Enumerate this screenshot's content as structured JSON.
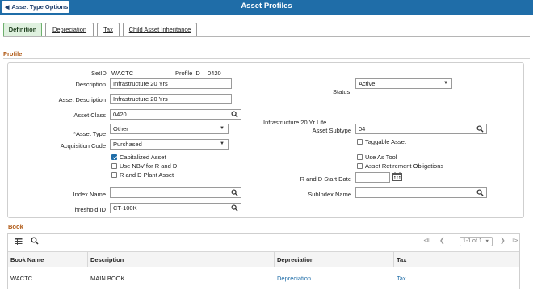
{
  "header": {
    "back_label": "Asset Type Options",
    "title": "Asset Profiles"
  },
  "tabs": [
    {
      "label": "Definition",
      "active": true
    },
    {
      "label": "Depreciation",
      "active": false
    },
    {
      "label": "Tax",
      "active": false
    },
    {
      "label": "Child Asset Inheritance",
      "active": false
    }
  ],
  "profile": {
    "section_title": "Profile",
    "setid_label": "SetID",
    "setid_value": "WACTC",
    "profile_id_label": "Profile ID",
    "profile_id_value": "0420",
    "description_label": "Description",
    "description_value": "Infrastructure 20 Yrs",
    "asset_description_label": "Asset Description",
    "asset_description_value": "Infrastructure 20 Yrs",
    "status_label": "Status",
    "status_value": "Active",
    "asset_class_label": "Asset Class",
    "asset_class_value": "0420",
    "asset_class_desc": "Infrastructure 20 Yr Life",
    "asset_type_label": "*Asset Type",
    "asset_type_value": "Other",
    "asset_subtype_label": "Asset Subtype",
    "asset_subtype_value": "04",
    "acquisition_code_label": "Acquisition Code",
    "acquisition_code_value": "Purchased",
    "taggable_label": "Taggable Asset",
    "capitalized_label": "Capitalized Asset",
    "use_as_tool_label": "Use As Tool",
    "use_nbv_label": "Use NBV for R and D",
    "aro_label": "Asset Retirement Obligations",
    "rd_plant_label": "R and D Plant Asset",
    "rd_start_date_label": "R and D Start Date",
    "rd_start_date_value": "",
    "index_name_label": "Index Name",
    "index_name_value": "",
    "subindex_name_label": "SubIndex Name",
    "subindex_name_value": "",
    "threshold_id_label": "Threshold ID",
    "threshold_id_value": "CT-100K",
    "checkboxes": {
      "taggable": false,
      "capitalized": true,
      "use_as_tool": false,
      "use_nbv": false,
      "aro": false,
      "rd_plant": false
    }
  },
  "book": {
    "section_title": "Book",
    "pager_text": "1-1 of 1",
    "columns": [
      "Book Name",
      "Description",
      "Depreciation",
      "Tax"
    ],
    "rows": [
      {
        "book_name": "WACTC",
        "description": "MAIN BOOK",
        "depreciation": "Depreciation",
        "tax": "Tax"
      }
    ]
  },
  "colors": {
    "header": "#1f6da8",
    "section_title": "#b05a16",
    "link": "#1f6da8",
    "active_tab": "#dff1df"
  }
}
